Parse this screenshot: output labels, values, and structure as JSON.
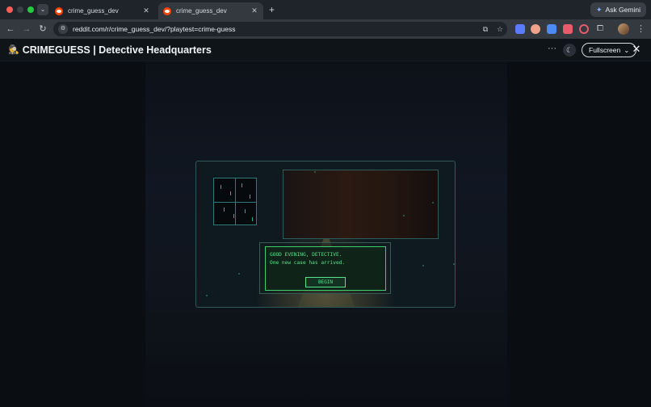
{
  "browser": {
    "tabs": [
      {
        "title": "crime_guess_dev",
        "active": false
      },
      {
        "title": "crime_guess_dev",
        "active": true
      }
    ],
    "new_tab_icon": "+",
    "ask_gemini_label": "Ask Gemini",
    "url": "reddit.com/r/crime_guess_dev/?playtest=crime-guess"
  },
  "app": {
    "icon": "🕵",
    "title": "CRIMEGUESS | Detective Headquarters",
    "fullscreen_label": "Fullscreen",
    "close_glyph": "✕",
    "more_glyph": "···"
  },
  "game": {
    "dialog_line1": "GOOD EVENING, DETECTIVE.",
    "dialog_line2": "One new case has arrived.",
    "begin_label": "BEGIN"
  },
  "colors": {
    "terminal_green": "#57e389",
    "reddit_orange": "#ff4500",
    "room_border": "#2f5a5a"
  }
}
